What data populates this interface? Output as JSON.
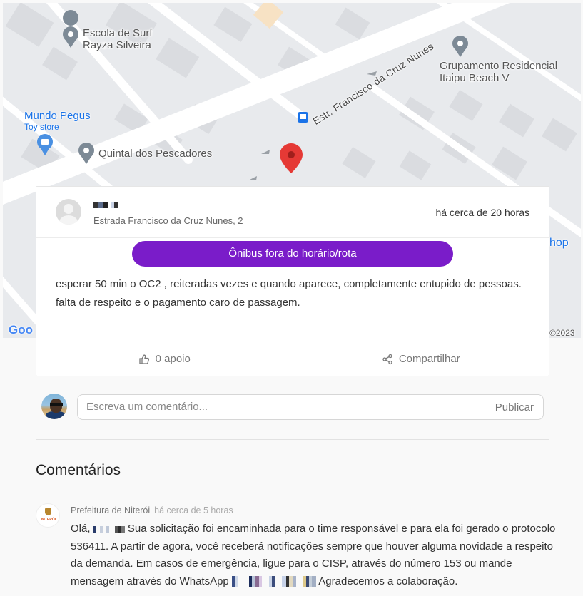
{
  "map": {
    "pois": [
      {
        "name": "Escola de Surf\nRayza Silveira",
        "icon": "map-pin-icon"
      },
      {
        "name": "Grupamento Residencial\nItaipu Beach V",
        "icon": "map-pin-icon"
      },
      {
        "name": "Mundo Pegus",
        "subtitle": "Toy store",
        "icon": "shopping-bag-icon"
      },
      {
        "name": "Quintal dos Pescadores",
        "icon": "map-pin-icon"
      }
    ],
    "street": "Estr. Francisco da Cruz Nunes",
    "partial_poi": "hop",
    "google_logo": "Goo",
    "copyright": "©2023"
  },
  "report": {
    "address": "Estrada Francisco da Cruz Nunes, 2",
    "time": "há cerca de 20 horas",
    "category": "Ônibus fora do horário/rota",
    "description": "esperar 50 min o OC2 , reiteradas vezes e quando aparece, completamente entupido de pessoas. falta de respeito e o pagamento caro de passagem.",
    "support_label": "0 apoio",
    "share_label": "Compartilhar"
  },
  "comment_input": {
    "placeholder": "Escreva um comentário...",
    "publish_label": "Publicar"
  },
  "comments": {
    "title": "Comentários",
    "items": [
      {
        "author": "Prefeitura de Niterói",
        "time": "há cerca de 5 horas",
        "greeting": "Olá,",
        "text1": "Sua solicitação foi encaminhada para o time responsável e para ela foi gerado o protocolo 536411. A partir de agora, você receberá notificações sempre que houver alguma novidade a respeito da demanda. Em casos de emergência, ligue para o CISP, através do número 153 ou mande mensagem através do WhatsApp",
        "text2": "Agradecemos a colaboração."
      }
    ]
  },
  "colors": {
    "accent": "#7a1cc9",
    "map_bg": "#e8eaed",
    "pin_red": "#e53935",
    "poi_blue": "#1a73e8"
  }
}
